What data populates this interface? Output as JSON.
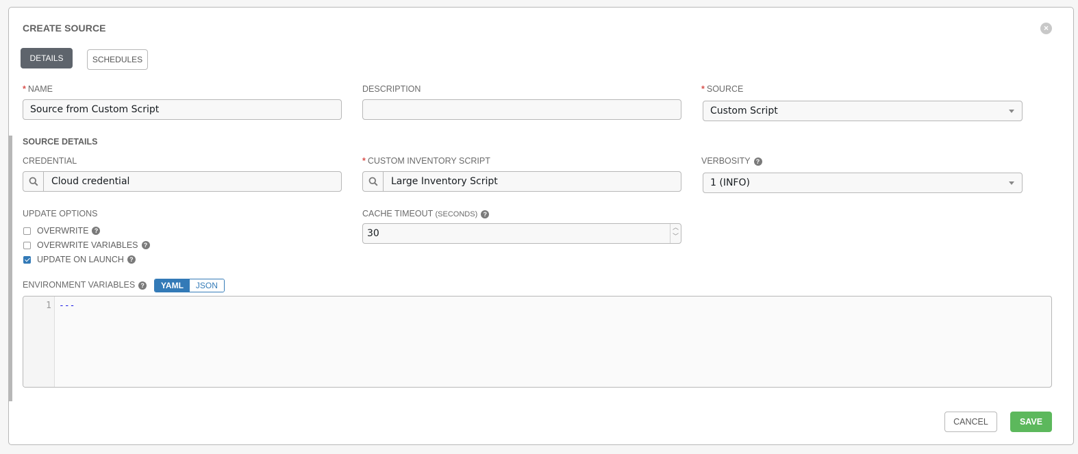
{
  "dialog": {
    "title": "CREATE SOURCE",
    "close_icon": "close-circle-icon"
  },
  "tabs": [
    {
      "label": "DETAILS",
      "active": true
    },
    {
      "label": "SCHEDULES",
      "active": false
    }
  ],
  "fields": {
    "name": {
      "label": "NAME",
      "required": "*",
      "value": "Source from Custom Script"
    },
    "description": {
      "label": "DESCRIPTION",
      "value": ""
    },
    "source": {
      "label": "SOURCE",
      "required": "*",
      "value": "Custom Script"
    }
  },
  "source_details": {
    "title": "SOURCE DETAILS",
    "credential": {
      "label": "CREDENTIAL",
      "value": "Cloud credential",
      "icon": "search-icon"
    },
    "custom_inventory_script": {
      "label": "CUSTOM INVENTORY SCRIPT",
      "required": "*",
      "value": "Large Inventory Script",
      "icon": "search-icon"
    },
    "verbosity": {
      "label": "VERBOSITY",
      "value": "1 (INFO)",
      "help": "?"
    },
    "update_options": {
      "label": "UPDATE OPTIONS",
      "options": [
        {
          "label": "OVERWRITE",
          "checked": false
        },
        {
          "label": "OVERWRITE VARIABLES",
          "checked": false
        },
        {
          "label": "UPDATE ON LAUNCH",
          "checked": true
        }
      ]
    },
    "cache_timeout": {
      "label": "CACHE TIMEOUT",
      "label_suffix": "(SECONDS)",
      "value": "30"
    },
    "environment_variables": {
      "label": "ENVIRONMENT VARIABLES",
      "modes": [
        "YAML",
        "JSON"
      ],
      "active_mode": "YAML",
      "line_numbers": [
        "1"
      ],
      "content": "---"
    }
  },
  "help_glyph": "?",
  "actions": {
    "cancel": "CANCEL",
    "save": "SAVE"
  },
  "colors": {
    "primary": "#337ab7",
    "success": "#5cb85c",
    "required": "#d9534f",
    "tab_active": "#5e646c"
  }
}
